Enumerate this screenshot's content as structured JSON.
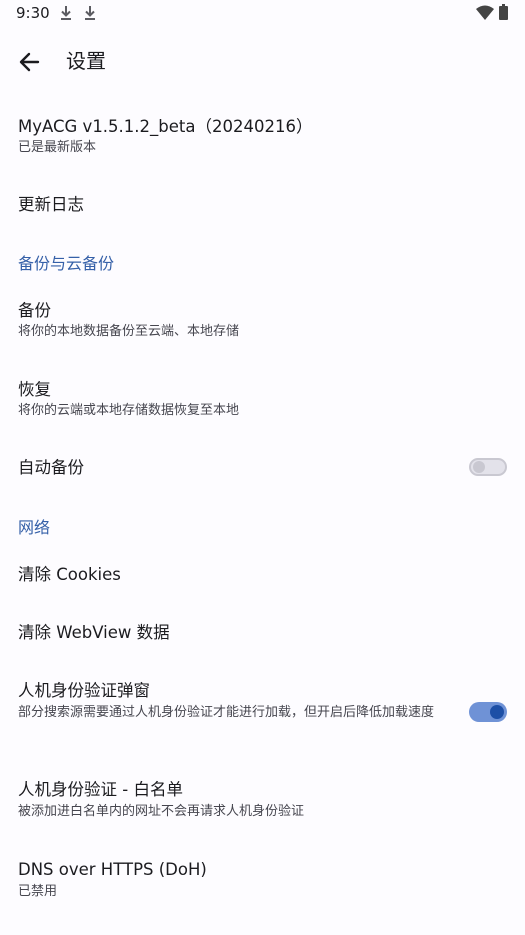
{
  "status_bar": {
    "time": "9:30"
  },
  "app_bar": {
    "title": "设置"
  },
  "about": {
    "title": "MyACG v1.5.1.2_beta（20240216）",
    "subtitle": "已是最新版本"
  },
  "changelog": {
    "title": "更新日志"
  },
  "backup_section": {
    "header": "备份与云备份",
    "backup": {
      "title": "备份",
      "subtitle": "将你的本地数据备份至云端、本地存储"
    },
    "restore": {
      "title": "恢复",
      "subtitle": "将你的云端或本地存储数据恢复至本地"
    },
    "auto_backup": {
      "title": "自动备份",
      "enabled": false
    }
  },
  "network_section": {
    "header": "网络",
    "clear_cookies": {
      "title": "清除 Cookies"
    },
    "clear_webview": {
      "title": "清除 WebView 数据"
    },
    "captcha_popup": {
      "title": "人机身份验证弹窗",
      "subtitle": "部分搜索源需要通过人机身份验证才能进行加载，但开启后降低加载速度",
      "enabled": true
    },
    "captcha_whitelist": {
      "title": "人机身份验证 - 白名单",
      "subtitle": "被添加进白名单内的网址不会再请求人机身份验证"
    },
    "doh": {
      "title": "DNS over HTTPS (DoH)",
      "subtitle": "已禁用"
    }
  },
  "colors": {
    "accent": "#3560a8",
    "switch_on_track": "#6f92d6",
    "switch_on_thumb": "#1d4fa6"
  }
}
